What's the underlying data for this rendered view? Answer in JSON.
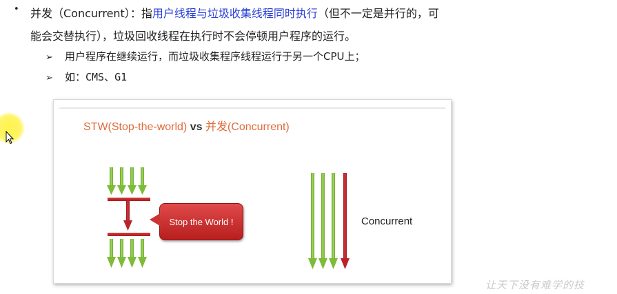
{
  "text": {
    "bullet": "•",
    "line1_prefix": "并发（Concurrent）：指",
    "line1_highlight": "用户线程与垃圾收集线程同时执行",
    "line1_suffix": "（但不一定是并行的，可",
    "line2": "能会交替执行），垃圾回收线程在执行时不会停顿用户程序的运行。",
    "sub_arrow": "➢",
    "sub1": "用户程序在继续运行，而垃圾收集程序线程运行于另一个CPU上；",
    "sub2": "如：CMS、G1"
  },
  "diagram": {
    "title_stw": "STW(Stop-the-world)",
    "title_vs": "vs",
    "title_concurrent": "并发(Concurrent)",
    "bubble_label": "Stop the World !",
    "concurrent_label": "Concurrent"
  },
  "watermark": "让天下没有难学的技",
  "colors": {
    "highlight": "#2a3fd8",
    "title": "#e06b3a",
    "user_thread": "#8dc63f",
    "gc_thread": "#c1272d",
    "bubble": "#cc3232"
  }
}
